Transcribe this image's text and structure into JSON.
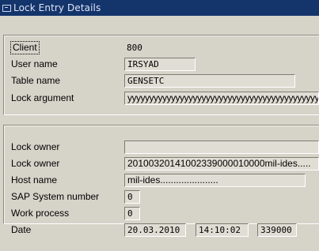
{
  "window": {
    "title": "Lock Entry Details"
  },
  "lock_entry": {
    "client_label": "Client",
    "client_value": "800",
    "user_name_label": "User name",
    "user_name_value": "IRSYAD",
    "table_name_label": "Table name",
    "table_name_value": "GENSETC",
    "lock_argument_label": "Lock argument",
    "lock_argument_value": "yyyyyyyyyyyyyyyyyyyyyyyyyyyyyyyyyyyyyyyyyyyy"
  },
  "owner_details": {
    "lock_owner1_label": "Lock owner",
    "lock_owner1_value": "",
    "lock_owner2_label": "Lock owner",
    "lock_owner2_value": "20100320141002339000010000mil-ides.....",
    "host_name_label": "Host name",
    "host_name_value": "mil-ides......................",
    "sap_system_number_label": "SAP System number",
    "sap_system_number_value": "0",
    "work_process_label": "Work process",
    "work_process_value": "0",
    "date_label": "Date",
    "date_value": "20.03.2010",
    "time_value": "14:10:02",
    "microseconds_value": "339000"
  }
}
